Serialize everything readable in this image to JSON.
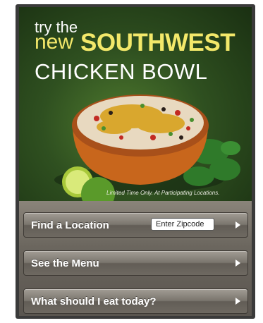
{
  "promo": {
    "headline_line1": "try the",
    "headline_new": "new",
    "headline_brand": "SOUTHWEST",
    "headline_line3": "CHICKEN BOWL",
    "disclaimer": "Limited Time Only. At Participating Locations.",
    "accent_color": "#f3e86a"
  },
  "menu": {
    "find_location": {
      "label": "Find a Location",
      "zip_placeholder": "Enter Zipcode"
    },
    "see_menu": {
      "label": "See the Menu"
    },
    "what_to_eat": {
      "label": "What should I eat today?"
    }
  },
  "icons": {
    "row_arrow": "chevron-right-icon"
  }
}
